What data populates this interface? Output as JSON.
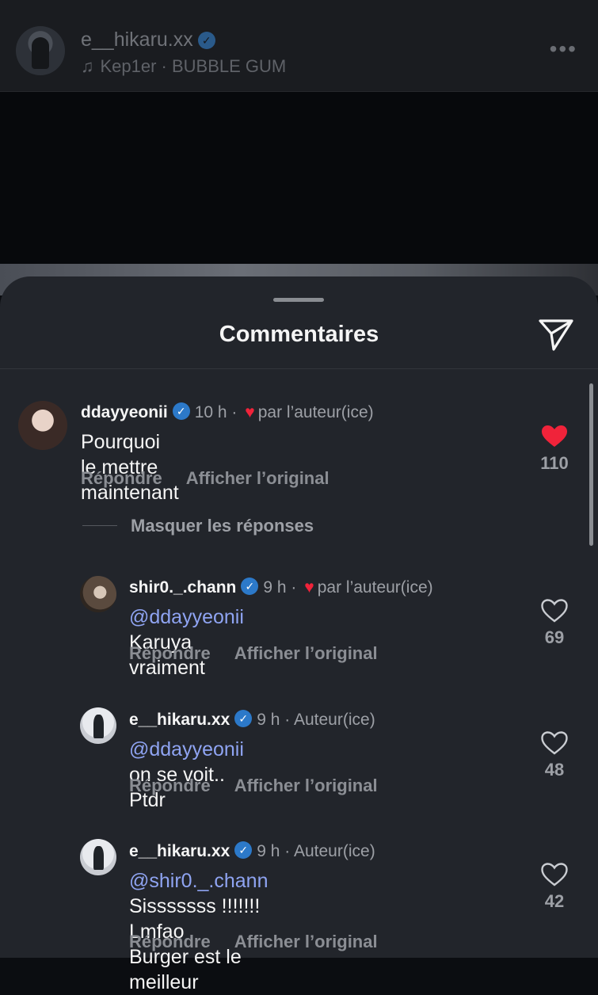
{
  "post": {
    "username": "e__hikaru.xx",
    "music": "Kep1er · BUBBLE GUM"
  },
  "sheet": {
    "title": "Commentaires"
  },
  "comments": [
    {
      "username": "ddayyeonii",
      "time": "10 h",
      "tag": "par l’auteur(ice)",
      "text": "Pourquoi le mettre maintenant",
      "reply": "Répondre",
      "translate": "Afficher l’original",
      "likes": "110",
      "liked": true
    },
    {
      "username": "shir0._.chann",
      "time": "9 h",
      "tag": "par l’auteur(ice)",
      "mention": "@ddayyeonii",
      "text": " Karuya vraiment",
      "reply": "Répondre",
      "translate": "Afficher l’original",
      "likes": "69",
      "liked": false
    },
    {
      "username": "e__hikaru.xx",
      "time": "9 h",
      "tag": "Auteur(ice)",
      "mention": "@ddayyeonii",
      "text": " on se voit.. Ptdr",
      "reply": "Répondre",
      "translate": "Afficher l’original",
      "likes": "48",
      "liked": false
    },
    {
      "username": "e__hikaru.xx",
      "time": "9 h",
      "tag": "Auteur(ice)",
      "mention": "@shir0._.chann",
      "text": " Sisssssss !!!!!!! Lmfao",
      "text2": "Burger est le meilleur",
      "reply": "Répondre",
      "translate": "Afficher l’original",
      "likes": "42",
      "liked": false
    }
  ],
  "hide_replies": "Masquer les réponses",
  "colors": {
    "accent_like": "#f0233a",
    "mention": "#8fa4f2",
    "verified": "#2c79c9"
  }
}
